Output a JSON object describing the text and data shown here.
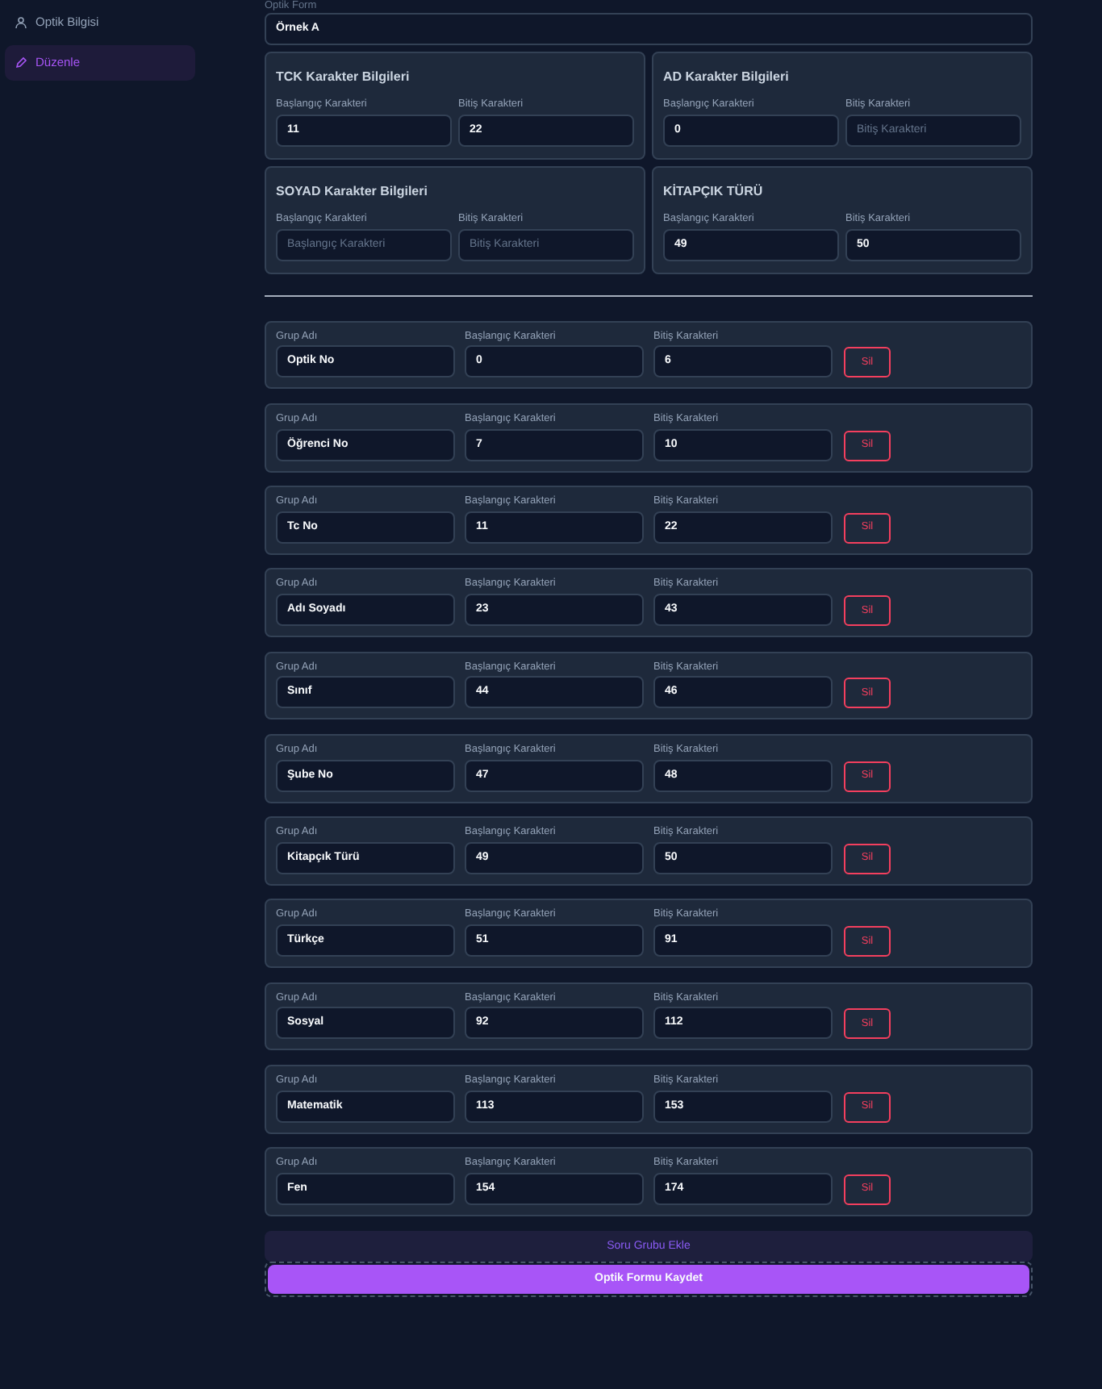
{
  "sidebar": {
    "items": [
      {
        "label": "Optik Bilgisi",
        "selected": false
      },
      {
        "label": "Düzenle",
        "selected": true
      }
    ]
  },
  "form_name": {
    "label": "Optik Form",
    "value": "Örnek A"
  },
  "sections": [
    {
      "title": "TCK Karakter Bilgileri",
      "fields": [
        {
          "label": "Başlangıç Karakteri",
          "value": "11"
        },
        {
          "label": "Bitiş Karakteri",
          "value": "22"
        }
      ]
    },
    {
      "title": "AD Karakter Bilgileri",
      "fields": [
        {
          "label": "Başlangıç Karakteri",
          "value": "0"
        },
        {
          "label": "Bitiş Karakteri",
          "placeholder": "Bitiş Karakteri"
        }
      ]
    },
    {
      "title": "SOYAD Karakter Bilgileri",
      "fields": [
        {
          "label": "Başlangıç Karakteri",
          "placeholder": "Başlangıç Karakteri"
        },
        {
          "label": "Bitiş Karakteri",
          "placeholder": "Bitiş Karakteri"
        }
      ]
    },
    {
      "title": "KİTAPÇIK TÜRÜ",
      "fields": [
        {
          "label": "Başlangıç Karakteri",
          "value": "49"
        },
        {
          "label": "Bitiş Karakteri",
          "value": "50"
        }
      ]
    }
  ],
  "groups": [
    {
      "name_label": "Grup Adı",
      "name": "Optik No",
      "start_label": "Başlangıç Karakteri",
      "start": "0",
      "end_label": "Bitiş Karakteri",
      "end": "6",
      "delete": "Sil"
    },
    {
      "name_label": "Grup Adı",
      "name": "Öğrenci No",
      "start_label": "Başlangıç Karakteri",
      "start": "7",
      "end_label": "Bitiş Karakteri",
      "end": "10",
      "delete": "Sil"
    },
    {
      "name_label": "Grup Adı",
      "name": "Tc No",
      "start_label": "Başlangıç Karakteri",
      "start": "11",
      "end_label": "Bitiş Karakteri",
      "end": "22",
      "delete": "Sil"
    },
    {
      "name_label": "Grup Adı",
      "name": "Adı Soyadı",
      "start_label": "Başlangıç Karakteri",
      "start": "23",
      "end_label": "Bitiş Karakteri",
      "end": "43",
      "delete": "Sil"
    },
    {
      "name_label": "Grup Adı",
      "name": "Sınıf",
      "start_label": "Başlangıç Karakteri",
      "start": "44",
      "end_label": "Bitiş Karakteri",
      "end": "46",
      "delete": "Sil"
    },
    {
      "name_label": "Grup Adı",
      "name": "Şube No",
      "start_label": "Başlangıç Karakteri",
      "start": "47",
      "end_label": "Bitiş Karakteri",
      "end": "48",
      "delete": "Sil"
    },
    {
      "name_label": "Grup Adı",
      "name": "Kitapçık Türü",
      "start_label": "Başlangıç Karakteri",
      "start": "49",
      "end_label": "Bitiş Karakteri",
      "end": "50",
      "delete": "Sil"
    },
    {
      "name_label": "Grup Adı",
      "name": "Türkçe",
      "start_label": "Başlangıç Karakteri",
      "start": "51",
      "end_label": "Bitiş Karakteri",
      "end": "91",
      "delete": "Sil"
    },
    {
      "name_label": "Grup Adı",
      "name": "Sosyal",
      "start_label": "Başlangıç Karakteri",
      "start": "92",
      "end_label": "Bitiş Karakteri",
      "end": "112",
      "delete": "Sil"
    },
    {
      "name_label": "Grup Adı",
      "name": "Matematik",
      "start_label": "Başlangıç Karakteri",
      "start": "113",
      "end_label": "Bitiş Karakteri",
      "end": "153",
      "delete": "Sil"
    },
    {
      "name_label": "Grup Adı",
      "name": "Fen",
      "start_label": "Başlangıç Karakteri",
      "start": "154",
      "end_label": "Bitiş Karakteri",
      "end": "174",
      "delete": "Sil"
    }
  ],
  "add_group_button": "Soru Grubu Ekle",
  "save_button": "Optik Formu Kaydet"
}
